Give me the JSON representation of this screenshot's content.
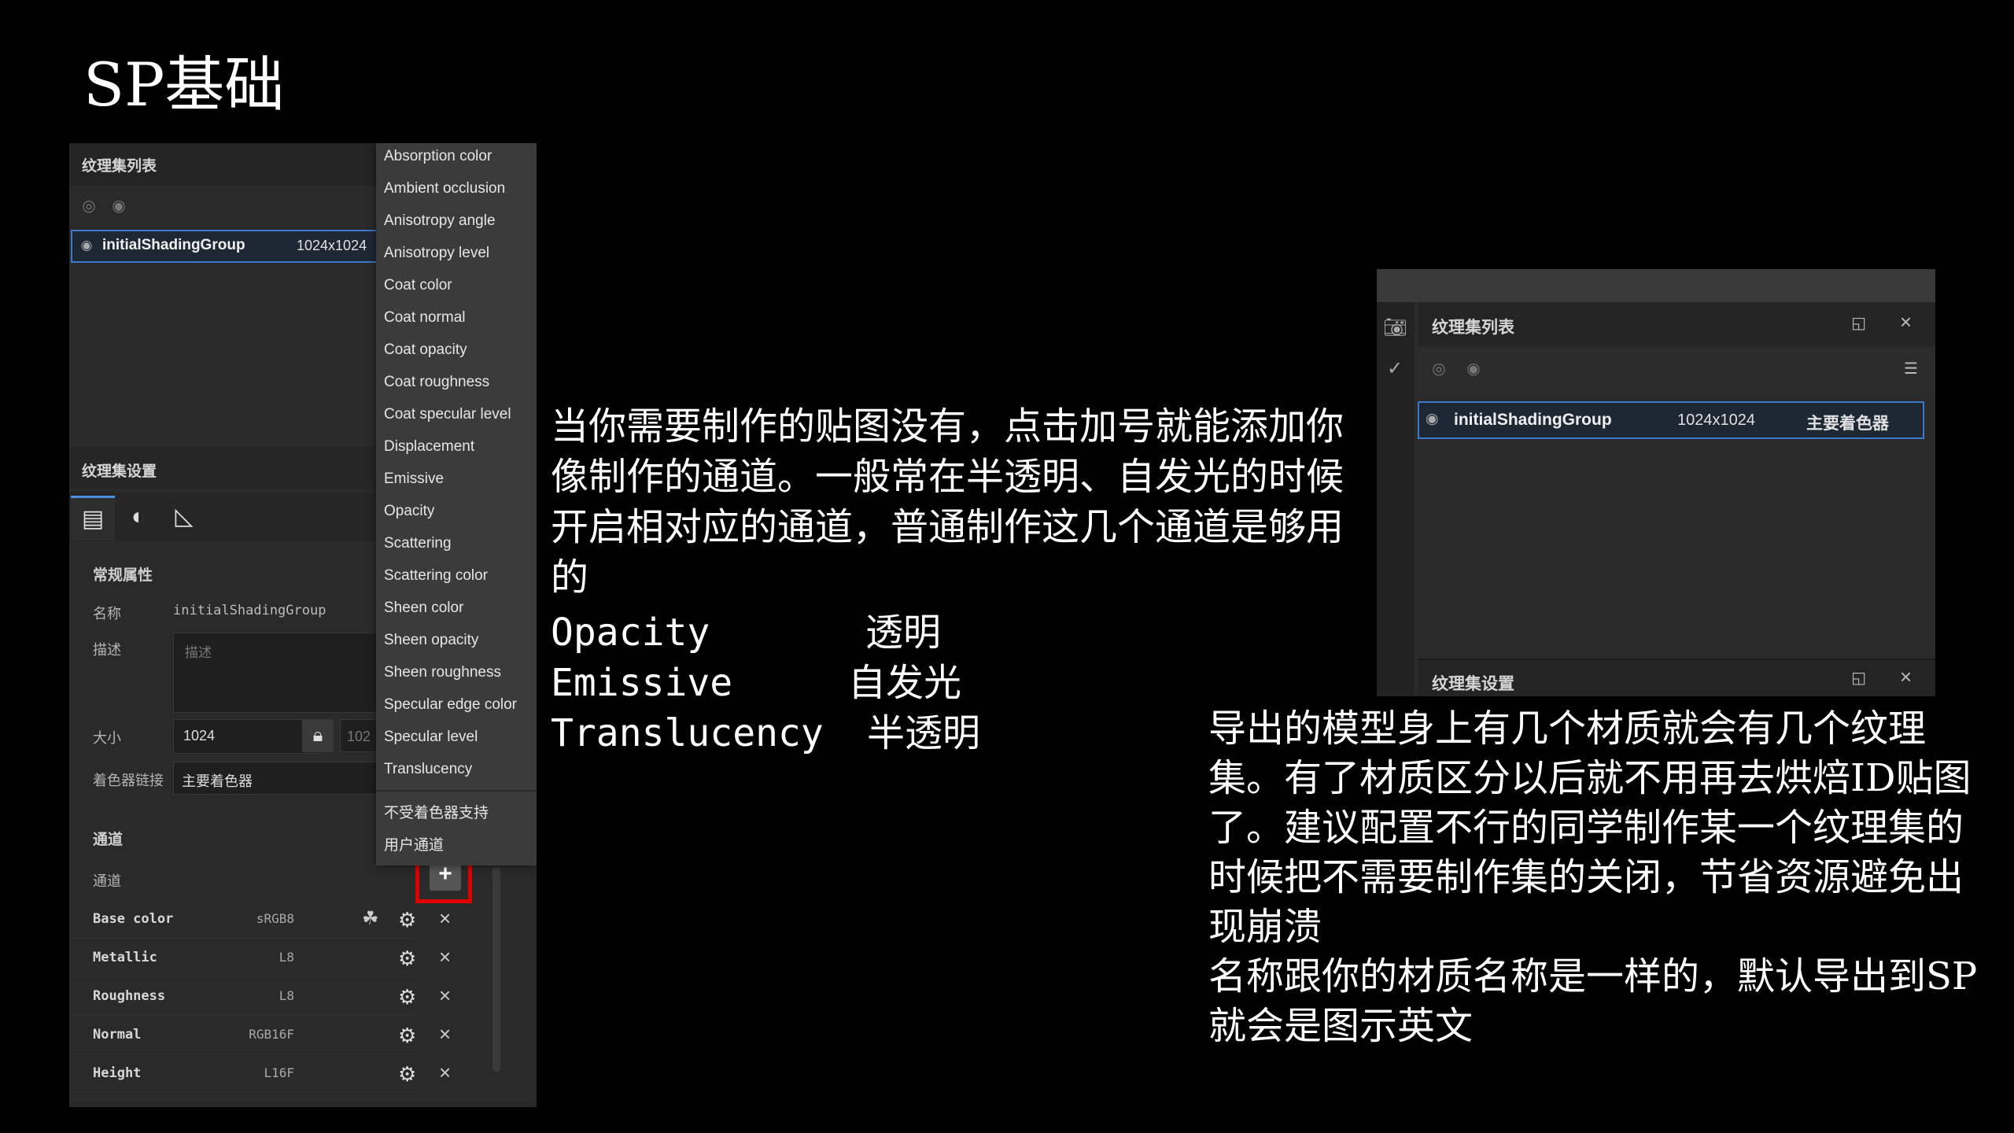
{
  "slide": {
    "title": "SP基础"
  },
  "left_panel": {
    "texture_set_list": {
      "title": "纹理集列表",
      "item": {
        "name": "initialShadingGroup",
        "resolution": "1024x1024"
      }
    },
    "texture_set_settings": {
      "title": "纹理集设置",
      "general_properties": "常规属性",
      "name_label": "名称",
      "name_value": "initialShadingGroup",
      "description_label": "描述",
      "description_placeholder": "描述",
      "size_label": "大小",
      "size_value": "1024",
      "size_partial": "102",
      "shader_link_label": "着色器链接",
      "shader_value": "主要着色器",
      "channels_title": "通道",
      "channels_label": "通道",
      "add_button": "+",
      "channels": [
        {
          "name": "Base color",
          "format": "sRGB8"
        },
        {
          "name": "Metallic",
          "format": "L8"
        },
        {
          "name": "Roughness",
          "format": "L8"
        },
        {
          "name": "Normal",
          "format": "RGB16F"
        },
        {
          "name": "Height",
          "format": "L16F"
        }
      ]
    },
    "channel_menu": {
      "items": [
        "Absorption color",
        "Ambient occlusion",
        "Anisotropy angle",
        "Anisotropy level",
        "Coat color",
        "Coat normal",
        "Coat opacity",
        "Coat roughness",
        "Coat specular level",
        "Displacement",
        "Emissive",
        "Opacity",
        "Scattering",
        "Scattering color",
        "Sheen color",
        "Sheen opacity",
        "Sheen roughness",
        "Specular edge color",
        "Specular level",
        "Translucency"
      ],
      "extra_items": [
        "不受着色器支持",
        "用户通道"
      ]
    }
  },
  "center_text": {
    "paragraph": "当你需要制作的贴图没有，点击加号就能添加你像制作的通道。一般常在半透明、自发光的时候开启相对应的通道，普通制作这几个通道是够用的",
    "terms": [
      {
        "en": "Opacity",
        "cn": "透明"
      },
      {
        "en": "Emissive",
        "cn": "自发光"
      },
      {
        "en": "Translucency",
        "cn": "半透明"
      }
    ]
  },
  "right_panel": {
    "texture_set_list_title": "纹理集列表",
    "item": {
      "name": "initialShadingGroup",
      "resolution": "1024x1024",
      "shader": "主要着色器"
    },
    "texture_set_settings_title": "纹理集设置"
  },
  "right_text": {
    "paragraph": "导出的模型身上有几个材质就会有几个纹理集。有了材质区分以后就不用再去烘焙ID贴图了。建议配置不行的同学制作某一个纹理集的时候把不需要制作集的关闭，节省资源避免出现崩溃",
    "paragraph2": "名称跟你的材质名称是一样的，默认导出到SP就会是图示英文"
  },
  "colors": {
    "accent_blue": "#3c79c7",
    "highlight_red": "#e00000",
    "background": "#000000"
  }
}
